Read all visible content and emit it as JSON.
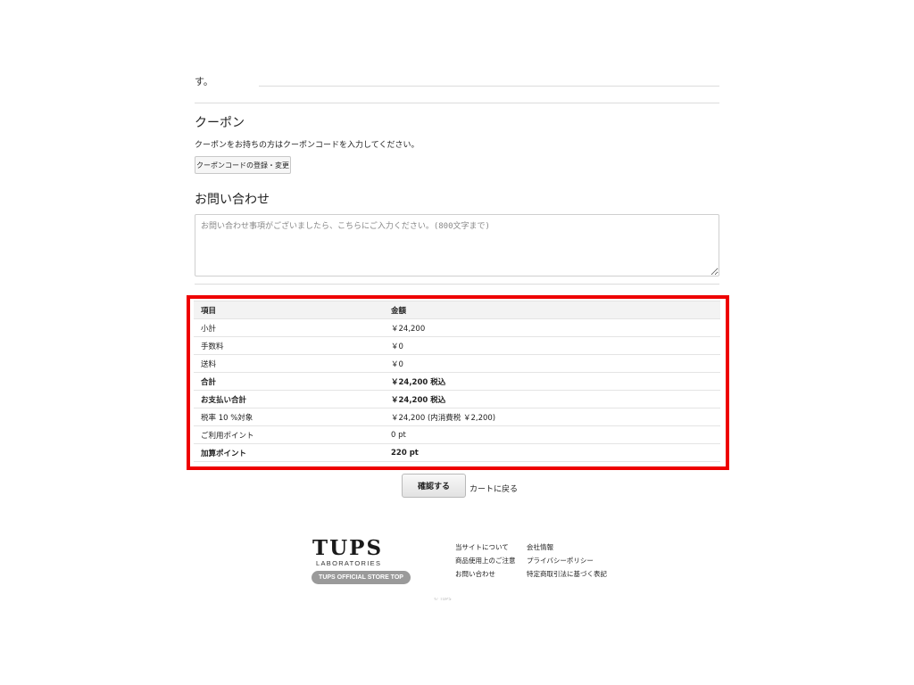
{
  "upper": {
    "cut_text": "す。"
  },
  "coupon": {
    "title": "クーポン",
    "description": "クーポンをお持ちの方はクーポンコードを入力してください。",
    "button_label": "クーポンコードの登録・変更"
  },
  "inquiry": {
    "title": "お問い合わせ",
    "placeholder": "お問い合わせ事項がございましたら、こちらにご入力ください。(800文字まで)"
  },
  "summary": {
    "headers": [
      "項目",
      "金額"
    ],
    "rows": [
      {
        "label": "小計",
        "value": "￥24,200"
      },
      {
        "label": "手数料",
        "value": "￥0"
      },
      {
        "label": "送料",
        "value": "￥0"
      },
      {
        "label": "合計",
        "value": "￥24,200 税込"
      },
      {
        "label": "お支払い合計",
        "value": "￥24,200 税込"
      },
      {
        "label": "税率 10 %対象",
        "value": "￥24,200 (内消費税 ￥2,200)"
      },
      {
        "label": "ご利用ポイント",
        "value": "0 pt"
      },
      {
        "label": "加算ポイント",
        "value": "220 pt"
      }
    ],
    "highlight_color": "#ee0000"
  },
  "actions": {
    "confirm_label": "確認する",
    "back_label": "カートに戻る"
  },
  "footer": {
    "logo_text": "TUPS",
    "logo_sub": "LABORATORIES",
    "store_top_label": "TUPS OFFICIAL STORE TOP",
    "links_col1": [
      "当サイトについて",
      "商品使用上のご注意",
      "お問い合わせ"
    ],
    "links_col2": [
      "会社情報",
      "プライバシーポリシー",
      "特定商取引法に基づく表記"
    ],
    "copyright": "© TUPS"
  }
}
